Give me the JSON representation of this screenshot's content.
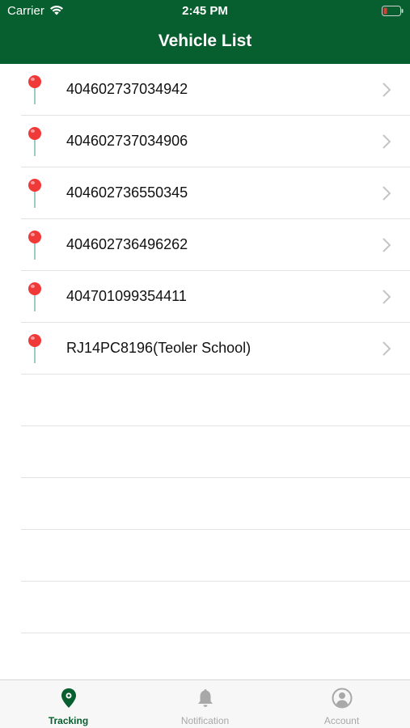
{
  "status_bar": {
    "carrier": "Carrier",
    "time": "2:45 PM"
  },
  "header": {
    "title": "Vehicle List"
  },
  "vehicles": [
    {
      "label": "404602737034942",
      "icon": "map-pin-icon"
    },
    {
      "label": "404602737034906",
      "icon": "map-pin-icon"
    },
    {
      "label": "404602736550345",
      "icon": "map-pin-icon"
    },
    {
      "label": "404602736496262",
      "icon": "map-pin-icon"
    },
    {
      "label": "404701099354411",
      "icon": "map-pin-icon"
    },
    {
      "label": "RJ14PC8196(Teoler School)",
      "icon": "map-pin-icon"
    }
  ],
  "tabs": [
    {
      "label": "Tracking",
      "icon": "location-pin-icon",
      "active": true
    },
    {
      "label": "Notification",
      "icon": "bell-icon",
      "active": false
    },
    {
      "label": "Account",
      "icon": "user-circle-icon",
      "active": false
    }
  ],
  "colors": {
    "header_bg": "#075e2e",
    "active_tab": "#075e2e",
    "inactive_tab": "#a8a8a8",
    "pin": "#f03a3a"
  }
}
